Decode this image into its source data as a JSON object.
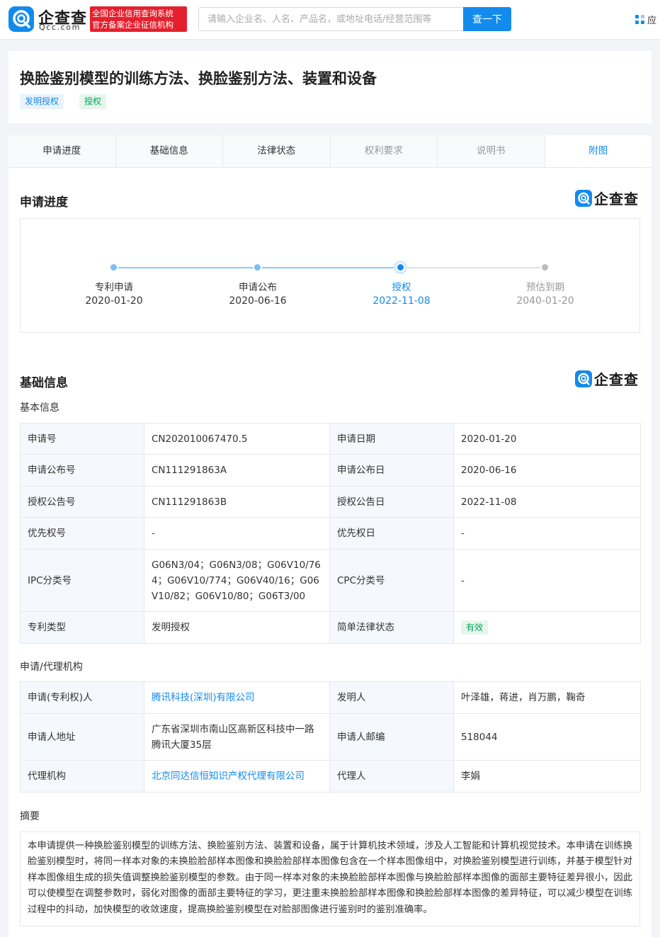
{
  "header": {
    "logo_cn": "企查查",
    "logo_en": "Qcc.com",
    "cert_line1": "全国企业信用查询系统",
    "cert_line2": "官方备案企业征信机构",
    "search_placeholder": "请输入企业名、人名、产品名，或地址电话/经营范围等",
    "search_button": "查一下",
    "app_link": "应"
  },
  "patent": {
    "title": "换脸鉴别模型的训练方法、换脸鉴别方法、装置和设备",
    "tags": [
      "发明授权",
      "授权"
    ]
  },
  "tabs": [
    {
      "label": "申请进度"
    },
    {
      "label": "基础信息"
    },
    {
      "label": "法律状态"
    },
    {
      "label": "权利要求"
    },
    {
      "label": "说明书"
    },
    {
      "label": "附图"
    }
  ],
  "progress": {
    "title": "申请进度",
    "watermark": "企查查",
    "steps": [
      {
        "label": "专利申请",
        "date": "2020-01-20",
        "state": "done"
      },
      {
        "label": "申请公布",
        "date": "2020-06-16",
        "state": "done"
      },
      {
        "label": "授权",
        "date": "2022-11-08",
        "state": "current"
      },
      {
        "label": "预估到期",
        "date": "2040-01-20",
        "state": "future"
      }
    ]
  },
  "basic": {
    "title": "基础信息",
    "watermark": "企查查",
    "subtitle": "基本信息",
    "rows": [
      {
        "k1": "申请号",
        "v1": "CN202010067470.5",
        "k2": "申请日期",
        "v2": "2020-01-20"
      },
      {
        "k1": "申请公布号",
        "v1": "CN111291863A",
        "k2": "申请公布日",
        "v2": "2020-06-16"
      },
      {
        "k1": "授权公告号",
        "v1": "CN111291863B",
        "k2": "授权公告日",
        "v2": "2022-11-08"
      },
      {
        "k1": "优先权号",
        "v1": "-",
        "k2": "优先权日",
        "v2": "-"
      },
      {
        "k1": "IPC分类号",
        "v1": "G06N3/04；G06N3/08；G06V10/764；G06V10/774；G06V40/16；G06V10/82；G06V10/80；G06T3/00",
        "k2": "CPC分类号",
        "v2": "-"
      },
      {
        "k1": "专利类型",
        "v1": "发明授权",
        "k2": "简单法律状态",
        "v2": "有效"
      }
    ]
  },
  "agency": {
    "subtitle": "申请/代理机构",
    "rows": [
      {
        "k1": "申请(专利权)人",
        "v1": "腾讯科技(深圳)有限公司",
        "k2": "发明人",
        "v2": "叶泽雄，蒋进，肖万鹏，鞠奇"
      },
      {
        "k1": "申请人地址",
        "v1": "广东省深圳市南山区高新区科技中一路腾讯大厦35层",
        "k2": "申请人邮编",
        "v2": "518044"
      },
      {
        "k1": "代理机构",
        "v1": "北京同达信恒知识产权代理有限公司",
        "k2": "代理人",
        "v2": "李娟"
      }
    ]
  },
  "abstract": {
    "subtitle": "摘要",
    "text": "本申请提供一种换脸鉴别模型的训练方法、换脸鉴别方法、装置和设备，属于计算机技术领域，涉及人工智能和计算机视觉技术。本申请在训练换脸鉴别模型时，将同一样本对象的未换脸脸部样本图像和换脸脸部样本图像包含在一个样本图像组中，对换脸鉴别模型进行训练，并基于模型针对样本图像组生成的损失值调整换脸鉴别模型的参数。由于同一样本对象的未换脸脸部样本图像与换脸脸部样本图像的面部主要特征差异很小，因此可以使模型在调整参数时，弱化对图像的面部主要特征的学习，更注重未换脸脸部样本图像和换脸脸部样本图像的差异特征，可以减少模型在训练过程中的抖动，加快模型的收敛速度，提高换脸鉴别模型在对脸部图像进行鉴别时的鉴别准确率。"
  },
  "colors": {
    "accent": "#128bed",
    "green": "#00a55a",
    "red_badge": "#e5202e",
    "future_gray": "#bbbbbb"
  }
}
